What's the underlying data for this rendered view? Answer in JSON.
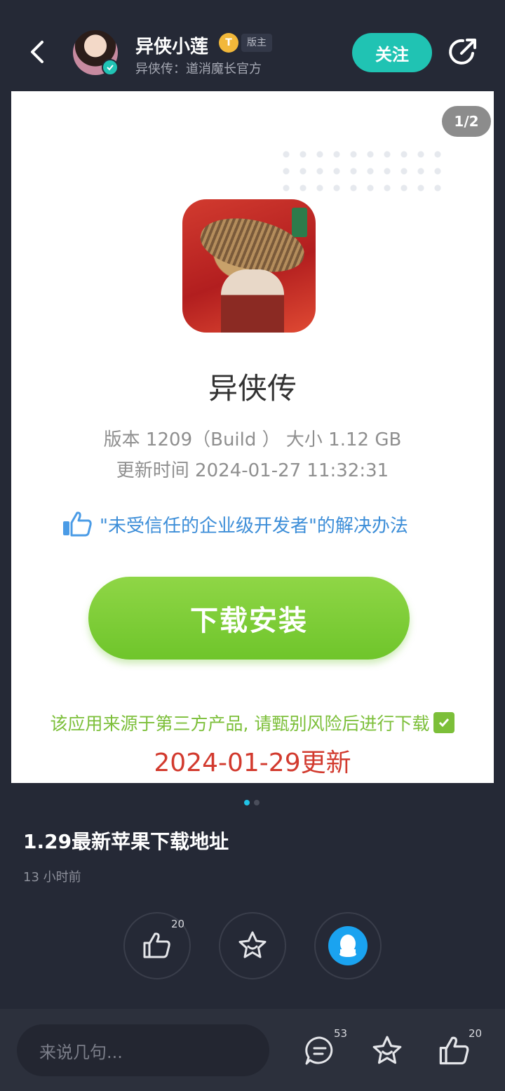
{
  "header": {
    "author_name": "异侠小莲",
    "level_badge": "T",
    "role_tag": "版主",
    "author_subtitle": "异侠传：道消魔长官方",
    "follow_label": "关注"
  },
  "image_card": {
    "page_indicator": "1/2",
    "app_name": "异侠传",
    "meta_line": "版本 1209（Build ） 大小 1.12 GB",
    "updated_line": "更新时间 2024-01-27 11:32:31",
    "trust_link": "\"未受信任的企业级开发者\"的解决办法",
    "download_label": "下载安装",
    "risk_note": "该应用来源于第三方产品, 请甄别风险后进行下载",
    "update_date": "2024-01-29更新"
  },
  "post": {
    "title": "1.29最新苹果下载地址",
    "time": "13 小时前",
    "like_count": "20"
  },
  "bottom_bar": {
    "comment_placeholder": "来说几句...",
    "comment_count": "53",
    "like_count": "20"
  },
  "colors": {
    "background": "#252936",
    "accent_teal": "#20c3b3",
    "download_green": "#7cbf39",
    "update_red": "#d23a2e",
    "link_blue": "#3d8ed8",
    "qq_blue": "#1aa3f0"
  },
  "icons": [
    "back-icon",
    "verified-icon",
    "share-icon",
    "thumbs-up-icon",
    "star-icon",
    "qq-icon",
    "comment-icon",
    "check-icon"
  ]
}
